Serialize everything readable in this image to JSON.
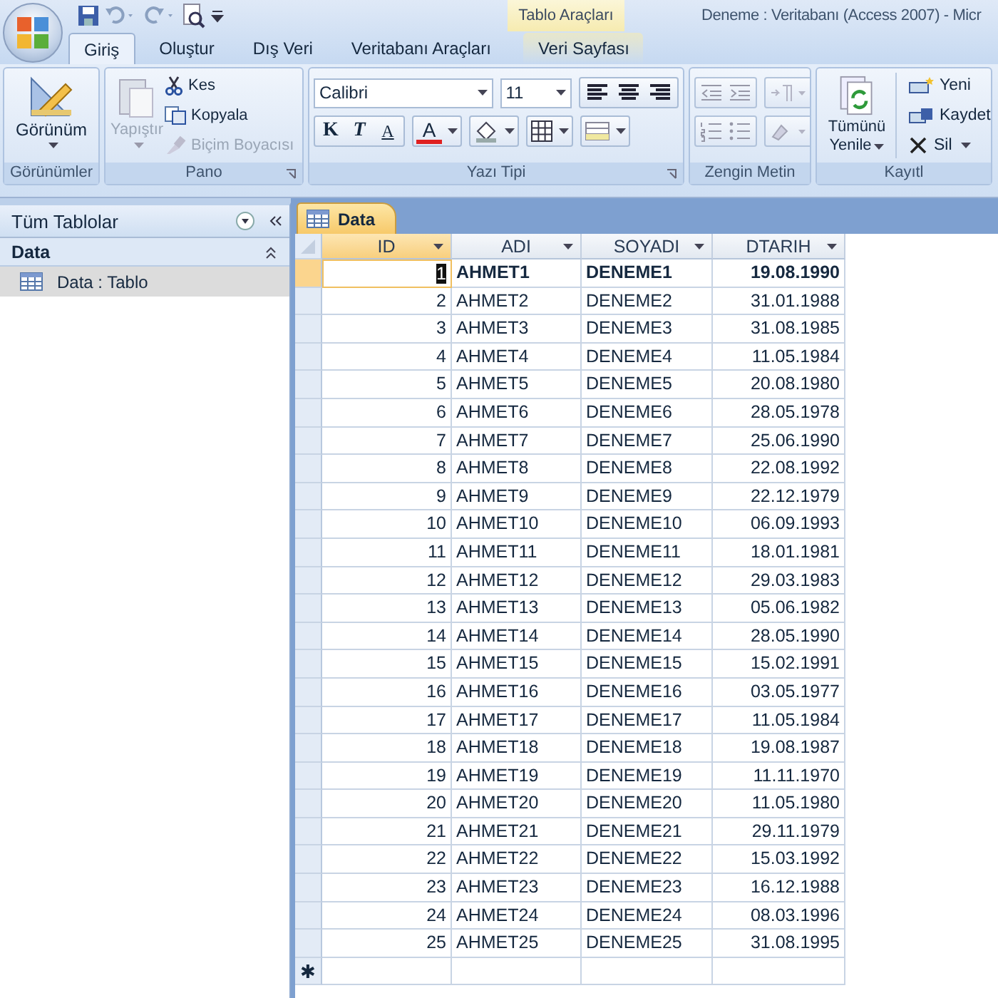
{
  "window": {
    "title": "Deneme : Veritabanı (Access 2007) - Micr",
    "contextual_tab": "Tablo Araçları"
  },
  "tabs": [
    {
      "label": "Giriş",
      "selected": true,
      "kind": "normal"
    },
    {
      "label": "Oluştur",
      "selected": false,
      "kind": "normal"
    },
    {
      "label": "Dış Veri",
      "selected": false,
      "kind": "normal"
    },
    {
      "label": "Veritabanı Araçları",
      "selected": false,
      "kind": "normal"
    },
    {
      "label": "Veri Sayfası",
      "selected": false,
      "kind": "contextual"
    }
  ],
  "ribbon": {
    "views": {
      "label": "Görünümler",
      "button": "Görünüm"
    },
    "clipboard": {
      "label": "Pano",
      "paste": {
        "label": "Yapıştır",
        "disabled": true
      },
      "cut": {
        "label": "Kes",
        "disabled": false
      },
      "copy": {
        "label": "Kopyala",
        "disabled": false
      },
      "format_painter": {
        "label": "Biçim Boyacısı",
        "disabled": true
      }
    },
    "font": {
      "label": "Yazı Tipi",
      "family": "Calibri",
      "size": "11",
      "style_buttons": [
        "K",
        "T",
        "A"
      ],
      "font_color": "A"
    },
    "rich_text": {
      "label": "Zengin Metin"
    },
    "records": {
      "label": "Kayıtl",
      "refresh": "Tümünü Yenile",
      "new": "Yeni",
      "save": "Kaydet",
      "delete": "Sil"
    }
  },
  "nav_pane": {
    "title": "Tüm Tablolar",
    "group": "Data",
    "items": [
      {
        "label": "Data : Tablo",
        "selected": true
      }
    ]
  },
  "datasheet": {
    "tab": "Data",
    "columns": [
      "ID",
      "ADI",
      "SOYADI",
      "DTARIH"
    ],
    "new_record_marker": "✱",
    "rows": [
      {
        "cells": [
          "1",
          "AHMET1",
          "DENEME1",
          "19.08.1990"
        ],
        "selected": true
      },
      {
        "cells": [
          "2",
          "AHMET2",
          "DENEME2",
          "31.01.1988"
        ],
        "selected": false
      },
      {
        "cells": [
          "3",
          "AHMET3",
          "DENEME3",
          "31.08.1985"
        ],
        "selected": false
      },
      {
        "cells": [
          "4",
          "AHMET4",
          "DENEME4",
          "11.05.1984"
        ],
        "selected": false
      },
      {
        "cells": [
          "5",
          "AHMET5",
          "DENEME5",
          "20.08.1980"
        ],
        "selected": false
      },
      {
        "cells": [
          "6",
          "AHMET6",
          "DENEME6",
          "28.05.1978"
        ],
        "selected": false
      },
      {
        "cells": [
          "7",
          "AHMET7",
          "DENEME7",
          "25.06.1990"
        ],
        "selected": false
      },
      {
        "cells": [
          "8",
          "AHMET8",
          "DENEME8",
          "22.08.1992"
        ],
        "selected": false
      },
      {
        "cells": [
          "9",
          "AHMET9",
          "DENEME9",
          "22.12.1979"
        ],
        "selected": false
      },
      {
        "cells": [
          "10",
          "AHMET10",
          "DENEME10",
          "06.09.1993"
        ],
        "selected": false
      },
      {
        "cells": [
          "11",
          "AHMET11",
          "DENEME11",
          "18.01.1981"
        ],
        "selected": false
      },
      {
        "cells": [
          "12",
          "AHMET12",
          "DENEME12",
          "29.03.1983"
        ],
        "selected": false
      },
      {
        "cells": [
          "13",
          "AHMET13",
          "DENEME13",
          "05.06.1982"
        ],
        "selected": false
      },
      {
        "cells": [
          "14",
          "AHMET14",
          "DENEME14",
          "28.05.1990"
        ],
        "selected": false
      },
      {
        "cells": [
          "15",
          "AHMET15",
          "DENEME15",
          "15.02.1991"
        ],
        "selected": false
      },
      {
        "cells": [
          "16",
          "AHMET16",
          "DENEME16",
          "03.05.1977"
        ],
        "selected": false
      },
      {
        "cells": [
          "17",
          "AHMET17",
          "DENEME17",
          "11.05.1984"
        ],
        "selected": false
      },
      {
        "cells": [
          "18",
          "AHMET18",
          "DENEME18",
          "19.08.1987"
        ],
        "selected": false
      },
      {
        "cells": [
          "19",
          "AHMET19",
          "DENEME19",
          "11.11.1970"
        ],
        "selected": false
      },
      {
        "cells": [
          "20",
          "AHMET20",
          "DENEME20",
          "11.05.1980"
        ],
        "selected": false
      },
      {
        "cells": [
          "21",
          "AHMET21",
          "DENEME21",
          "29.11.1979"
        ],
        "selected": false
      },
      {
        "cells": [
          "22",
          "AHMET22",
          "DENEME22",
          "15.03.1992"
        ],
        "selected": false
      },
      {
        "cells": [
          "23",
          "AHMET23",
          "DENEME23",
          "16.12.1988"
        ],
        "selected": false
      },
      {
        "cells": [
          "24",
          "AHMET24",
          "DENEME24",
          "08.03.1996"
        ],
        "selected": false
      },
      {
        "cells": [
          "25",
          "AHMET25",
          "DENEME25",
          "31.08.1995"
        ],
        "selected": false
      }
    ]
  }
}
